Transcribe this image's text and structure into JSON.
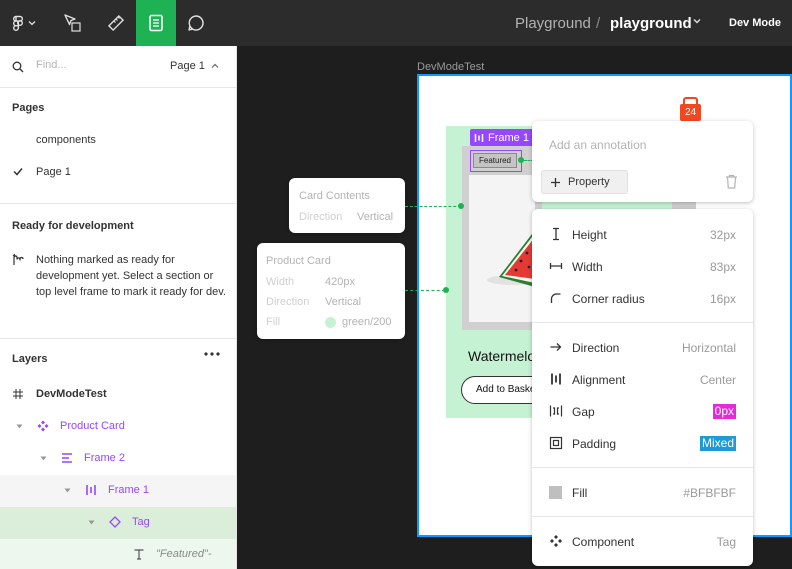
{
  "topbar": {
    "breadcrumb": "Playground",
    "separator": "/",
    "file_name": "playground",
    "mode": "Dev Mode"
  },
  "left_panel": {
    "search_placeholder": "Find...",
    "page_selector": "Page 1",
    "pages_title": "Pages",
    "pages": [
      "components",
      "Page 1"
    ],
    "ready_title": "Ready for development",
    "ready_message": "Nothing marked as ready for development yet. Select a section or top level frame to mark it ready for dev.",
    "layers_title": "Layers",
    "layers": [
      {
        "name": "DevModeTest",
        "icon": "frame-icon"
      },
      {
        "name": "Product Card",
        "icon": "component-icon"
      },
      {
        "name": "Frame 2",
        "icon": "vertical-stack-icon"
      },
      {
        "name": "Frame 1",
        "icon": "horizontal-stack-icon"
      },
      {
        "name": "Tag",
        "icon": "instance-icon"
      },
      {
        "name": "\"Featured\"-",
        "icon": "text-icon"
      }
    ]
  },
  "canvas": {
    "frame_label": "DevModeTest",
    "frame1_tag": "Frame 1",
    "featured": "Featured",
    "product_title": "Watermelon",
    "add_button": "Add to Basket",
    "annotation_count": "24"
  },
  "card_contents": {
    "title": "Card Contents",
    "direction_label": "Direction",
    "direction_value": "Vertical"
  },
  "product_card": {
    "title": "Product Card",
    "width_label": "Width",
    "width_value": "420px",
    "direction_label": "Direction",
    "direction_value": "Vertical",
    "fill_label": "Fill",
    "fill_value": "green/200"
  },
  "annotation": {
    "placeholder": "Add an annotation",
    "property_button": "Property"
  },
  "properties": {
    "height": {
      "label": "Height",
      "value": "32px"
    },
    "width": {
      "label": "Width",
      "value": "83px"
    },
    "corner_radius": {
      "label": "Corner radius",
      "value": "16px"
    },
    "direction": {
      "label": "Direction",
      "value": "Horizontal"
    },
    "alignment": {
      "label": "Alignment",
      "value": "Center"
    },
    "gap": {
      "label": "Gap",
      "value": "0px"
    },
    "padding": {
      "label": "Padding",
      "value": "Mixed"
    },
    "fill": {
      "label": "Fill",
      "value": "#BFBFBF"
    },
    "component": {
      "label": "Component",
      "value": "Tag"
    }
  },
  "colors": {
    "accent_green": "#1fb255",
    "selection_purple": "#9747ff",
    "frame_blue": "#0d99ff",
    "card_green": "#c6f2d4",
    "gap_pink": "#e32bd9",
    "padding_blue": "#1e9bd7",
    "badge_orange": "#f24822",
    "fill_swatch": "#bfbfbf"
  }
}
